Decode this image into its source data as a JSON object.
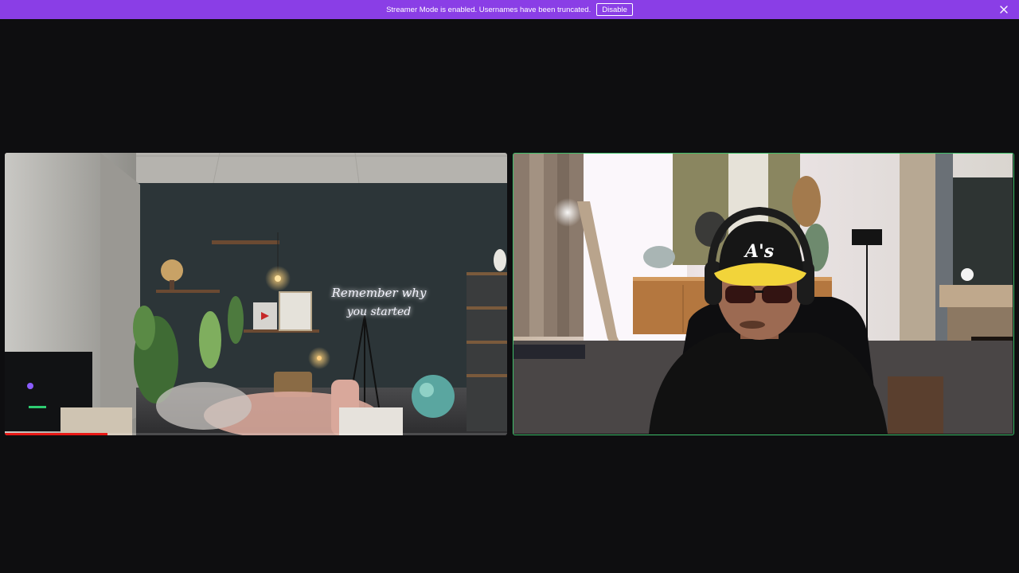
{
  "banner": {
    "message": "Streamer Mode is enabled. Usernames have been truncated.",
    "disable_label": "Disable",
    "background": "#8a3ee6",
    "close_icon": "close-icon"
  },
  "video_left": {
    "neon_sign_line1": "Remember why",
    "neon_sign_line2": "you started",
    "progress_fraction": 0.205,
    "progress_color": "#e91916"
  },
  "video_right": {
    "cap_logo": "A's",
    "active_speaker_border": "#3fbf6a"
  }
}
